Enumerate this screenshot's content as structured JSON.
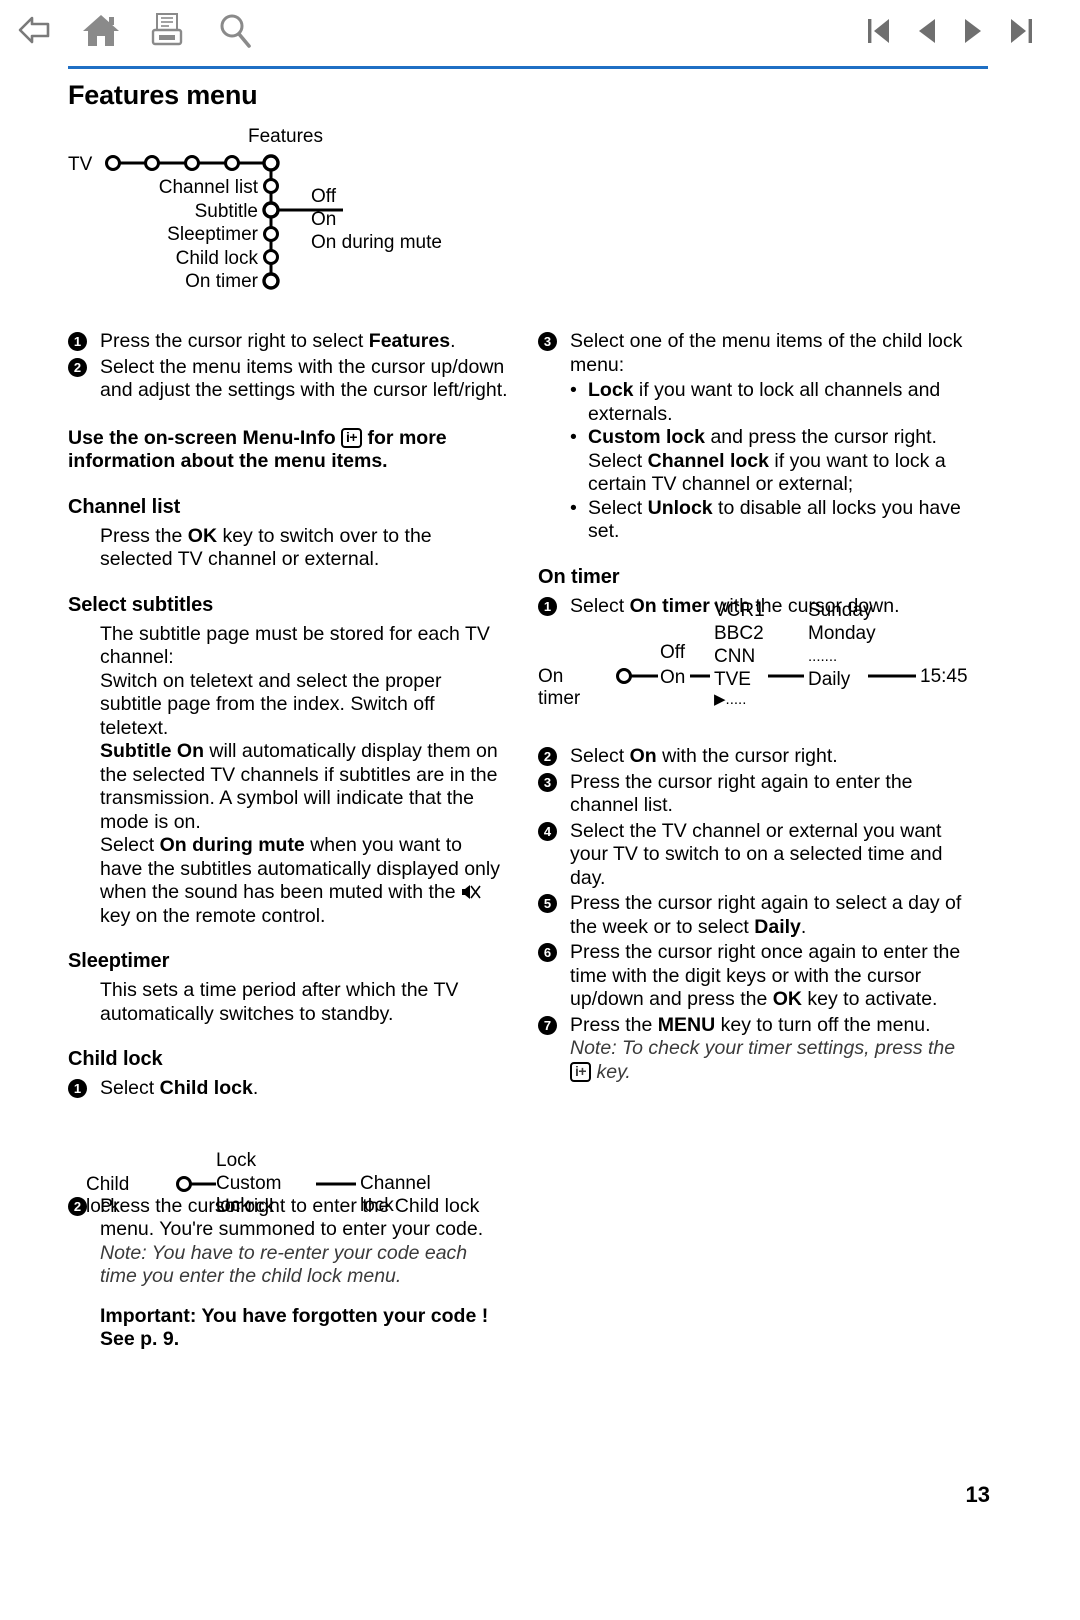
{
  "toolbar": {
    "left_icons": [
      {
        "name": "back-icon",
        "label": "Back"
      },
      {
        "name": "home-icon",
        "label": "Home"
      },
      {
        "name": "print-icon",
        "label": "Print"
      },
      {
        "name": "search-icon",
        "label": "Search"
      }
    ],
    "right_icons": [
      {
        "name": "first-page-icon",
        "label": "First page"
      },
      {
        "name": "previous-page-icon",
        "label": "Previous page"
      },
      {
        "name": "next-page-icon",
        "label": "Next page"
      },
      {
        "name": "last-page-icon",
        "label": "Last page"
      }
    ],
    "rule_color": "#1f6fc4"
  },
  "page": {
    "title": "Features menu",
    "number": "13"
  },
  "features_diagram": {
    "root_label": "TV",
    "head_label": "Features",
    "chain_nodes": 5,
    "children": [
      "Channel list",
      "Subtitle",
      "Sleeptimer",
      "Child lock",
      "On timer"
    ],
    "subtitle_options": [
      "Off",
      "On",
      "On during mute"
    ]
  },
  "intro": {
    "step1": "Press the cursor right to select ",
    "step1_bold": "Features",
    "step1_end": ".",
    "step2": "Select the menu items with the cursor up/down and adjust the settings with the cursor left/right.",
    "menu_info_line1": "Use the on-screen Menu-Info ",
    "menu_info_key": "i+",
    "menu_info_line2": " for more information about the menu items."
  },
  "channel_list": {
    "heading": "Channel list",
    "body_a": "Press the ",
    "body_ok": "OK",
    "body_b": " key to switch over to the selected TV channel or external."
  },
  "select_subtitles": {
    "heading": "Select subtitles",
    "para1": "The subtitle page must be stored for each TV channel:",
    "para2": "Switch on teletext and select the proper subtitle page from the index. Switch off teletext.",
    "para3_bold": "Subtitle On",
    "para3": " will automatically display them on the selected TV channels if subtitles are in the transmission. A symbol will indicate that the mode is on.",
    "para4_pre": "Select ",
    "para4_bold": "On during mute",
    "para4_mid": " when you want to have the subtitles automatically displayed only when the sound has been muted with the ",
    "para4_end": " key on the remote control.",
    "mute_icon": "mute-icon"
  },
  "sleeptimer": {
    "heading": "Sleeptimer",
    "body": "This sets a time period after which the TV automatically switches to standby."
  },
  "child_lock": {
    "heading": "Child lock",
    "step1_pre": "Select ",
    "step1_bold": "Child lock",
    "step1_end": ".",
    "diagram": {
      "root_label": "Child lock",
      "options": [
        "Lock",
        "Custom lock",
        "Unlock"
      ],
      "branch_from": "Custom lock",
      "branch_label": "Channel lock"
    },
    "step2": "Press the cursor right to enter the Child lock menu. You're summoned to enter your code.",
    "step2_note": "Note: You have to re-enter your code each time you enter the child lock menu.",
    "important_line1": "Important: You have forgotten your code !",
    "important_line2": "See p. 9."
  },
  "child_lock_menu": {
    "step3_intro": "Select one of the menu items of the child lock menu:",
    "items": [
      {
        "bold": "Lock",
        "rest": " if you want to lock all channels and externals."
      },
      {
        "bold": "Custom lock",
        "rest": " and press the cursor right. Select ",
        "bold2": "Channel lock",
        "rest2": " if you want to lock a certain TV channel or external;"
      },
      {
        "pre": "Select ",
        "bold": "Unlock",
        "rest": " to disable all locks you have set."
      }
    ]
  },
  "on_timer": {
    "heading": "On timer",
    "step1_pre": "Select ",
    "step1_bold": "On timer",
    "step1_end": " with the cursor down.",
    "diagram": {
      "root_label": "On timer",
      "onoff": [
        "Off",
        "On"
      ],
      "channels": [
        "VCR1",
        "BBC2",
        "CNN",
        "TVE"
      ],
      "channels_more": "▶.....",
      "days": [
        "Sunday",
        "Monday",
        ".......",
        "Daily"
      ],
      "time": "15:45"
    },
    "step2_pre": "Select ",
    "step2_bold": "On",
    "step2_end": " with the cursor right.",
    "step3": "Press the cursor right again to enter the channel list.",
    "step4": "Select the TV channel or external you want your TV to switch to on a selected time and day.",
    "step5_pre": "Press the cursor right again to select a day of the week or to select ",
    "step5_bold": "Daily",
    "step5_end": ".",
    "step6_pre": "Press the cursor right once again to enter the time with the digit keys or with the cursor up/down and press the ",
    "step6_bold": "OK",
    "step6_end": " key to activate.",
    "step7_pre": "Press the ",
    "step7_bold": "MENU",
    "step7_end": " key to turn off the menu.",
    "step7_note_pre": "Note: To check your timer settings, press the ",
    "step7_note_key": "i+",
    "step7_note_end": " key."
  },
  "step_numbers": [
    "1",
    "2",
    "3",
    "4",
    "5",
    "6",
    "7"
  ]
}
